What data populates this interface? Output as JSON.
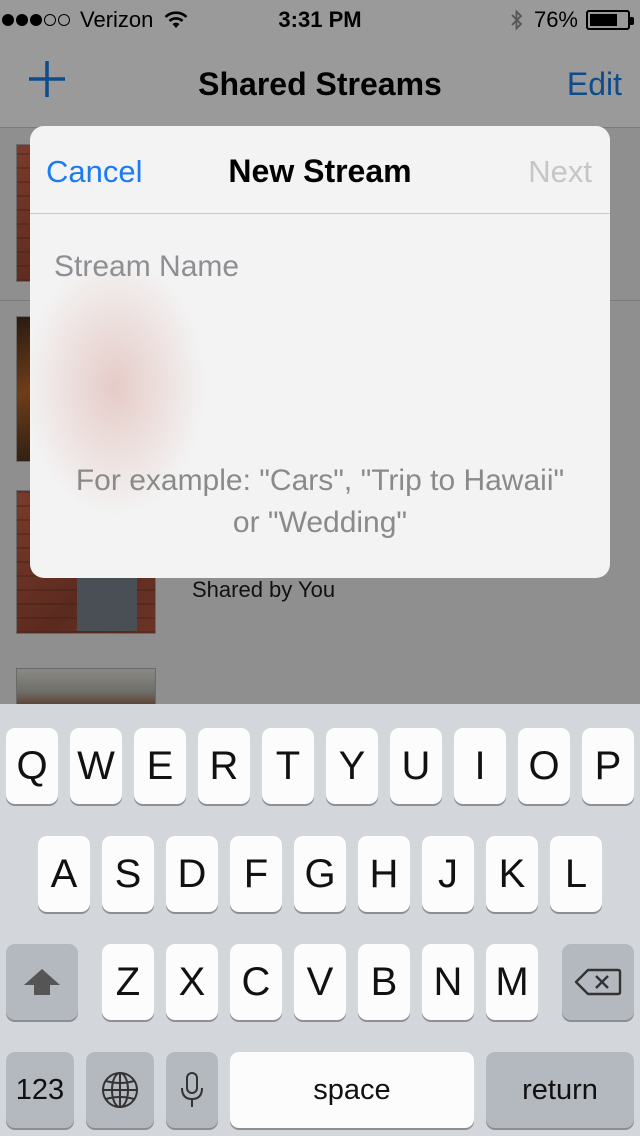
{
  "status_bar": {
    "carrier": "Verizon",
    "time": "3:31 PM",
    "battery_percent": "76%",
    "battery_level": 0.76,
    "signal_bars_filled": 3,
    "signal_bars_total": 5
  },
  "nav": {
    "title": "Shared Streams",
    "edit_label": "Edit",
    "add_icon": "plus-icon"
  },
  "background_list": {
    "shared_by": "Shared by You"
  },
  "modal": {
    "cancel_label": "Cancel",
    "title": "New Stream",
    "next_label": "Next",
    "stream_name_placeholder": "Stream Name",
    "stream_name_value": "",
    "hint": "For example: \"Cars\", \"Trip to Hawaii\" or \"Wedding\""
  },
  "keyboard": {
    "row1": [
      "Q",
      "W",
      "E",
      "R",
      "T",
      "Y",
      "U",
      "I",
      "O",
      "P"
    ],
    "row2": [
      "A",
      "S",
      "D",
      "F",
      "G",
      "H",
      "J",
      "K",
      "L"
    ],
    "row3": [
      "Z",
      "X",
      "C",
      "V",
      "B",
      "N",
      "M"
    ],
    "numbers_label": "123",
    "space_label": "space",
    "return_label": "return",
    "shift_icon": "shift-icon",
    "delete_icon": "delete-icon",
    "globe_icon": "globe-icon",
    "mic_icon": "microphone-icon"
  },
  "colors": {
    "accent": "#1a7cf5",
    "disabled": "#c6c6c8",
    "dim_overlay": "#8f8f8f",
    "keyboard_bg": "#d3d6db"
  }
}
